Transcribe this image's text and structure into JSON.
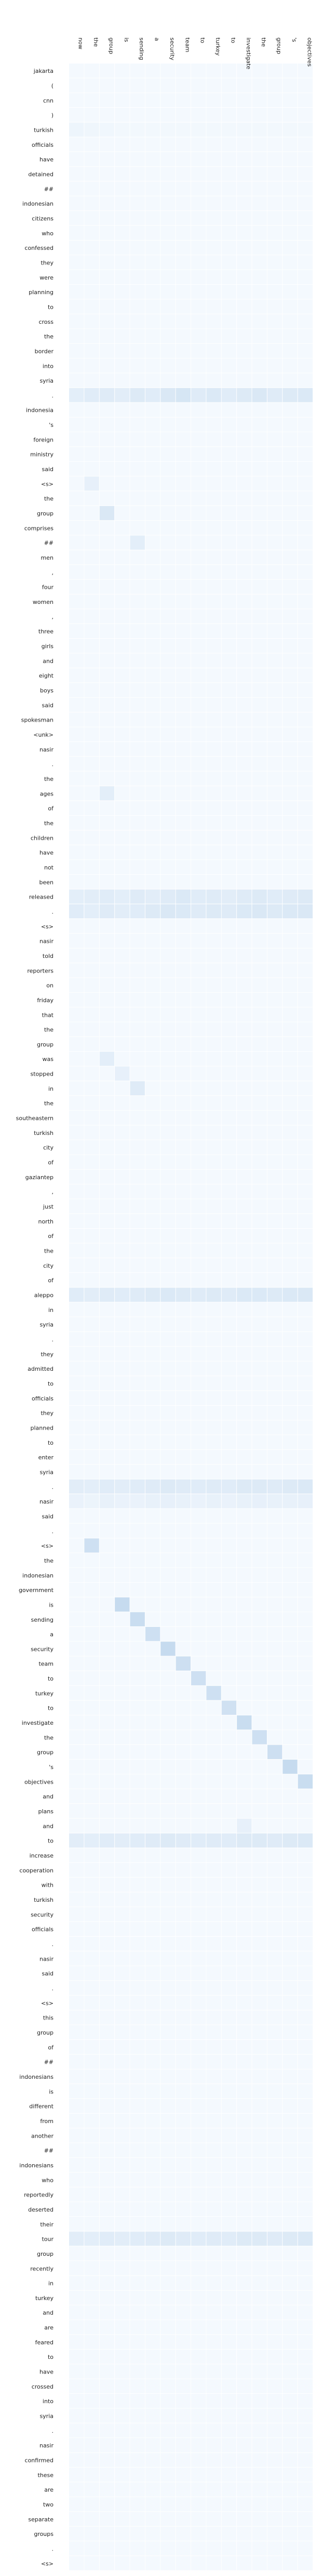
{
  "chart_data": {
    "type": "heatmap",
    "title": "",
    "xlabel": "",
    "ylabel": "",
    "x_labels": [
      "now",
      "the",
      "group",
      "is",
      "sending",
      "a",
      "security",
      "team",
      "to",
      "turkey",
      "to",
      "investigate",
      "the",
      "group",
      "'s",
      "objectives"
    ],
    "y_labels": [
      "jakarta",
      "(",
      "cnn",
      ")",
      "turkish",
      "officials",
      "have",
      "detained",
      "##",
      "indonesian",
      "citizens",
      "who",
      "confessed",
      "they",
      "were",
      "planning",
      "to",
      "cross",
      "the",
      "border",
      "into",
      "syria",
      ".",
      "indonesia",
      "'s",
      "foreign",
      "ministry",
      "said",
      "<s>",
      "the",
      "group",
      "comprises",
      "##",
      "men",
      ",",
      "four",
      "women",
      ",",
      "three",
      "girls",
      "and",
      "eight",
      "boys",
      "said",
      "spokesman",
      "<unk>",
      "nasir",
      ".",
      "the",
      "ages",
      "of",
      "the",
      "children",
      "have",
      "not",
      "been",
      "released",
      ".",
      "<s>",
      "nasir",
      "told",
      "reporters",
      "on",
      "friday",
      "that",
      "the",
      "group",
      "was",
      "stopped",
      "in",
      "the",
      "southeastern",
      "turkish",
      "city",
      "of",
      "gaziantep",
      ",",
      "just",
      "north",
      "of",
      "the",
      "city",
      "of",
      "aleppo",
      "in",
      "syria",
      ".",
      "they",
      "admitted",
      "to",
      "officials",
      "they",
      "planned",
      "to",
      "enter",
      "syria",
      ".",
      "nasir",
      "said",
      ".",
      "<s>",
      "the",
      "indonesian",
      "government",
      "is",
      "sending",
      "a",
      "security",
      "team",
      "to",
      "turkey",
      "to",
      "investigate",
      "the",
      "group",
      "'s",
      "objectives",
      "and",
      "plans",
      "and",
      "to",
      "increase",
      "cooperation",
      "with",
      "turkish",
      "security",
      "officials",
      ".",
      "nasir",
      "said",
      ".",
      "<s>",
      "this",
      "group",
      "of",
      "##",
      "indonesians",
      "is",
      "different",
      "from",
      "another",
      "##",
      "indonesians",
      "who",
      "reportedly",
      "deserted",
      "their",
      "tour",
      "group",
      "recently",
      "in",
      "turkey",
      "and",
      "are",
      "feared",
      "to",
      "have",
      "crossed",
      "into",
      "syria",
      ".",
      "nasir",
      "confirmed",
      "these",
      "are",
      "two",
      "separate",
      "groups",
      ".",
      "<s>"
    ],
    "value_range": [
      0,
      1
    ],
    "colormap": [
      "#f7fbff",
      "#c6dbef"
    ],
    "values_note": "",
    "baseline": 0.02,
    "strong_rows": [
      {
        "row": 4,
        "values": [
          0.06,
          0.05,
          0.04,
          0.03,
          0.03,
          0.03,
          0.03,
          0.03,
          0.03,
          0.03,
          0.03,
          0.03,
          0.03,
          0.03,
          0.03,
          0.03
        ]
      },
      {
        "row": 22,
        "values": [
          0.12,
          0.14,
          0.15,
          0.13,
          0.16,
          0.14,
          0.18,
          0.2,
          0.15,
          0.17,
          0.14,
          0.16,
          0.18,
          0.15,
          0.16,
          0.17
        ]
      },
      {
        "row": 56,
        "values": [
          0.12,
          0.13,
          0.14,
          0.12,
          0.15,
          0.13,
          0.15,
          0.17,
          0.14,
          0.15,
          0.13,
          0.15,
          0.16,
          0.14,
          0.15,
          0.16
        ]
      },
      {
        "row": 57,
        "values": [
          0.14,
          0.12,
          0.15,
          0.13,
          0.14,
          0.16,
          0.18,
          0.17,
          0.15,
          0.16,
          0.15,
          0.17,
          0.18,
          0.16,
          0.17,
          0.18
        ]
      },
      {
        "row": 83,
        "values": [
          0.14,
          0.13,
          0.15,
          0.14,
          0.15,
          0.16,
          0.17,
          0.16,
          0.15,
          0.16,
          0.15,
          0.17,
          0.17,
          0.16,
          0.17,
          0.18
        ]
      },
      {
        "row": 96,
        "values": [
          0.13,
          0.12,
          0.14,
          0.13,
          0.14,
          0.15,
          0.16,
          0.15,
          0.14,
          0.15,
          0.14,
          0.16,
          0.16,
          0.15,
          0.16,
          0.17
        ]
      },
      {
        "row": 97,
        "values": [
          0.08,
          0.07,
          0.09,
          0.08,
          0.08,
          0.09,
          0.1,
          0.09,
          0.08,
          0.09,
          0.08,
          0.09,
          0.1,
          0.09,
          0.09,
          0.1
        ]
      },
      {
        "row": 120,
        "values": [
          0.13,
          0.12,
          0.14,
          0.13,
          0.14,
          0.15,
          0.16,
          0.15,
          0.14,
          0.15,
          0.14,
          0.16,
          0.16,
          0.15,
          0.16,
          0.17
        ]
      },
      {
        "row": 147,
        "values": [
          0.13,
          0.12,
          0.14,
          0.13,
          0.14,
          0.15,
          0.16,
          0.15,
          0.14,
          0.15,
          0.14,
          0.16,
          0.16,
          0.15,
          0.16,
          0.17
        ]
      }
    ],
    "diagonal": [
      {
        "row": 100,
        "col": 1,
        "value": 0.25
      },
      {
        "row": 104,
        "col": 3,
        "value": 0.3
      },
      {
        "row": 105,
        "col": 4,
        "value": 0.28
      },
      {
        "row": 106,
        "col": 5,
        "value": 0.25
      },
      {
        "row": 107,
        "col": 6,
        "value": 0.3
      },
      {
        "row": 108,
        "col": 7,
        "value": 0.26
      },
      {
        "row": 109,
        "col": 8,
        "value": 0.25
      },
      {
        "row": 110,
        "col": 9,
        "value": 0.25
      },
      {
        "row": 111,
        "col": 10,
        "value": 0.24
      },
      {
        "row": 112,
        "col": 11,
        "value": 0.28
      },
      {
        "row": 113,
        "col": 12,
        "value": 0.25
      },
      {
        "row": 114,
        "col": 13,
        "value": 0.26
      },
      {
        "row": 115,
        "col": 14,
        "value": 0.3
      },
      {
        "row": 116,
        "col": 15,
        "value": 0.28
      },
      {
        "row": 119,
        "col": 11,
        "value": 0.1
      },
      {
        "row": 30,
        "col": 2,
        "value": 0.18
      },
      {
        "row": 28,
        "col": 1,
        "value": 0.1
      },
      {
        "row": 32,
        "col": 4,
        "value": 0.12
      },
      {
        "row": 67,
        "col": 2,
        "value": 0.12
      },
      {
        "row": 69,
        "col": 4,
        "value": 0.15
      },
      {
        "row": 68,
        "col": 3,
        "value": 0.1
      },
      {
        "row": 49,
        "col": 2,
        "value": 0.12
      }
    ]
  }
}
